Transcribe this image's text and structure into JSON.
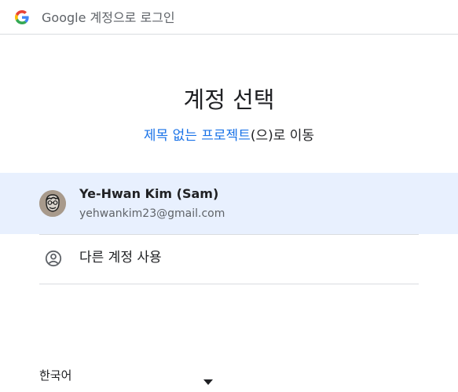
{
  "header": {
    "title": "Google 계정으로 로그인",
    "logo_icon": "google-g-icon"
  },
  "main": {
    "heading": "계정 선택",
    "subheading_link": "제목 없는 프로젝트",
    "subheading_suffix": "(으)로 이동"
  },
  "accounts": [
    {
      "name": "Ye-Hwan Kim (Sam)",
      "email": "yehwankim23@gmail.com",
      "avatar_icon": "avatar-icon"
    }
  ],
  "other_account": {
    "label": "다른 계정 사용",
    "icon": "person-circle-icon"
  },
  "footer": {
    "language": "한국어",
    "dropdown_icon": "caret-down-icon"
  },
  "colors": {
    "link": "#1a73e8",
    "selected_row": "#e8f0fe",
    "divider": "#dadce0",
    "secondary_text": "#5f6368"
  }
}
